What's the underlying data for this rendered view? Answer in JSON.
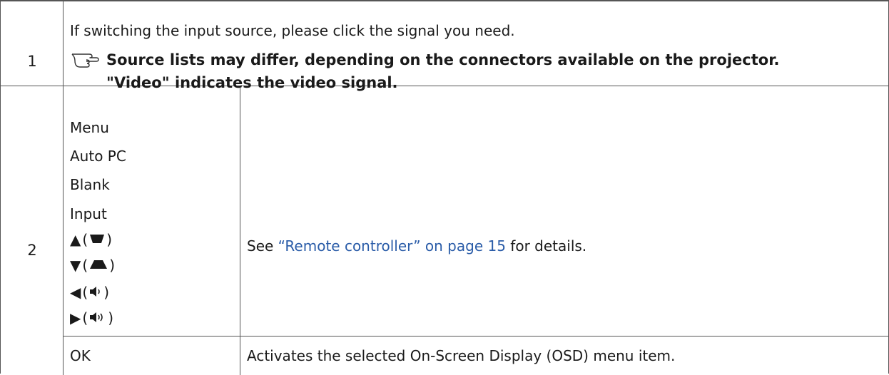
{
  "rows": [
    {
      "number": "1",
      "text": "If switching the input source, please click the signal you need.",
      "note_line1": "Source lists may differ, depending on the connectors available on the projector.",
      "note_line2": "\"Video\" indicates the video signal.",
      "note_icon": "hand-pointing-icon"
    },
    {
      "number": "2",
      "controls": [
        "Menu",
        "Auto PC",
        "Blank",
        "Input"
      ],
      "arrow_controls": [
        {
          "arrow": "▲",
          "icon": "keystone-down-icon"
        },
        {
          "arrow": "▼",
          "icon": "keystone-up-icon"
        },
        {
          "arrow": "◀",
          "icon": "volume-down-icon"
        },
        {
          "arrow": "▶",
          "icon": "volume-up-icon"
        }
      ],
      "description_prefix": "See ",
      "description_link": "“Remote controller” on page 15",
      "description_suffix": " for details.",
      "ok_label": "OK",
      "ok_description": "Activates the selected On-Screen Display (OSD) menu item."
    }
  ],
  "colors": {
    "link": "#2a5ca8",
    "border": "#555555",
    "text": "#1a1a1a"
  }
}
